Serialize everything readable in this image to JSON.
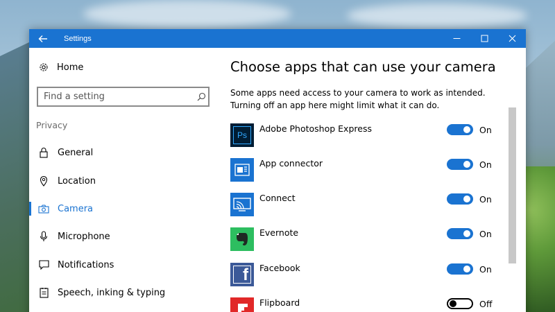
{
  "window": {
    "title": "Settings"
  },
  "sidebar": {
    "home_label": "Home",
    "search_placeholder": "Find a setting",
    "section_label": "Privacy",
    "items": [
      {
        "label": "General",
        "icon": "lock-icon",
        "active": false
      },
      {
        "label": "Location",
        "icon": "location-pin-icon",
        "active": false
      },
      {
        "label": "Camera",
        "icon": "camera-icon",
        "active": true
      },
      {
        "label": "Microphone",
        "icon": "microphone-icon",
        "active": false
      },
      {
        "label": "Notifications",
        "icon": "notification-icon",
        "active": false
      },
      {
        "label": "Speech, inking & typing",
        "icon": "speech-icon",
        "active": false
      }
    ]
  },
  "main": {
    "heading": "Choose apps that can use your camera",
    "description": "Some apps need access to your camera to work as intended. Turning off an app here might limit what it can do.",
    "apps": [
      {
        "name": "Adobe Photoshop Express",
        "state": "On",
        "on": true,
        "icon": "photoshop-express-icon",
        "icon_text": "Ps",
        "color": "#001d34"
      },
      {
        "name": "App connector",
        "state": "On",
        "on": true,
        "icon": "app-connector-icon",
        "color": "#1a73d1"
      },
      {
        "name": "Connect",
        "state": "On",
        "on": true,
        "icon": "connect-icon",
        "color": "#1a73d1"
      },
      {
        "name": "Evernote",
        "state": "On",
        "on": true,
        "icon": "evernote-icon",
        "color": "#2dbe60"
      },
      {
        "name": "Facebook",
        "state": "On",
        "on": true,
        "icon": "facebook-icon",
        "icon_text": "f",
        "color": "#3b5998"
      },
      {
        "name": "Flipboard",
        "state": "Off",
        "on": false,
        "icon": "flipboard-icon",
        "color": "#e12828"
      }
    ]
  },
  "colors": {
    "accent": "#1a73d1"
  }
}
